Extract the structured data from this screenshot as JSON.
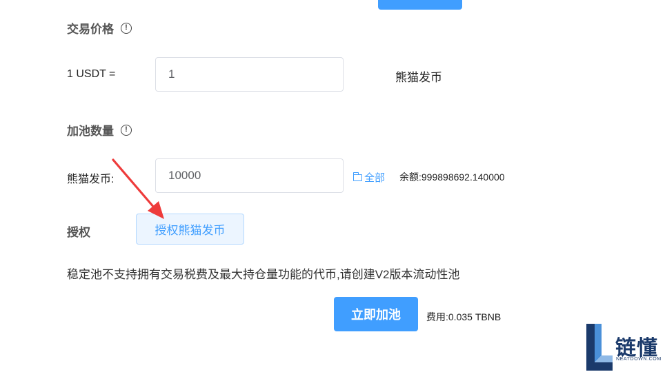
{
  "price_section": {
    "title": "交易价格",
    "row_label": "1 USDT =",
    "input_value": "1",
    "unit": "熊猫发币"
  },
  "amount_section": {
    "title": "加池数量",
    "row_label": "熊猫发币:",
    "input_value": "10000",
    "all_label": "全部",
    "balance": "余额:999898692.140000"
  },
  "approve_section": {
    "label": "授权",
    "button_label": "授权熊猫发币"
  },
  "notice": "稳定池不支持拥有交易税费及最大持仓量功能的代币,请创建V2版本流动性池",
  "submit": {
    "button_label": "立即加池",
    "fee": "费用:0.035 TBNB"
  },
  "watermark": {
    "title": "链懂",
    "subtitle": "NEATDOWN.COM"
  },
  "colors": {
    "primary": "#409eff",
    "arrow": "#ee3b3b",
    "watermark": "#1b3a6b"
  },
  "icons": {
    "info": "info-icon",
    "folder": "folder-icon",
    "arrow": "red-arrow-icon"
  }
}
